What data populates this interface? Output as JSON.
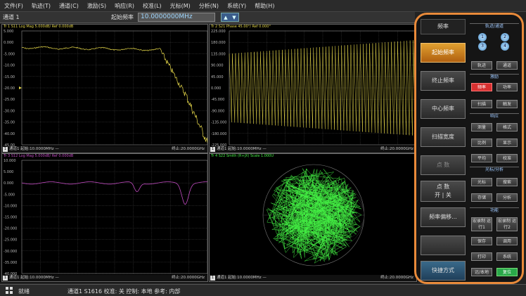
{
  "menubar": {
    "items": [
      "文件(F)",
      "轨迹(T)",
      "通道(C)",
      "激励(S)",
      "响应(R)",
      "校准(L)",
      "光标(M)",
      "分析(N)",
      "系统(Y)",
      "帮助(H)"
    ]
  },
  "toolbar": {
    "channel": "通道 1",
    "start_label": "起始频率",
    "start_value": "10.0000000MHz",
    "spin_up": "▲",
    "spin_down": "▼"
  },
  "trace1": {
    "header": "Tr 1  S11 Log Mag 5.000dB/ Ref 0.000dB",
    "y_ticks": [
      "5.000",
      "0.000",
      "-5.000",
      "-10.00",
      "-15.00",
      "-20.00",
      "-25.00",
      "-30.00",
      "-35.00",
      "-40.00",
      "-45.00"
    ],
    "footer_ch": "1",
    "footer_left": "通道1  起始:10.0000MHz  —",
    "footer_right": "终止:20.0000GHz"
  },
  "trace2": {
    "header": "Tr 2  S21 Phase 45.00°/ Ref 0.000°",
    "y_ticks": [
      "225.000",
      "180.000",
      "135.000",
      "90.000",
      "45.000",
      "0.000",
      "-45.000",
      "-90.000",
      "-135.000",
      "-180.000",
      "-225.000"
    ],
    "footer_ch": "1",
    "footer_left": "通道1  起始:10.0000MHz  —",
    "footer_right": "终止:20.0000GHz"
  },
  "trace3": {
    "header": "Tr 3  S12 Log Mag 5.000dB/ Ref 0.000dB",
    "y_ticks": [
      "10.000",
      "5.000",
      "0.000",
      "-5.000",
      "-10.000",
      "-15.000",
      "-20.000",
      "-25.000",
      "-30.000",
      "-35.000",
      "-40.000"
    ],
    "footer_ch": "1",
    "footer_left": "通道1  起始:10.0000MHz  —",
    "footer_right": "终止:20.0000GHz"
  },
  "trace4": {
    "header": "Tr 4  S22 Smith (R+jX) Scale 1.000U",
    "footer_ch": "1",
    "footer_left": "通道1  起始:10.0000MHz  —",
    "footer_right": "终止:20.0000GHz"
  },
  "panel": {
    "title": "频率",
    "buttons": [
      "起始频率",
      "终止频率",
      "中心频率",
      "扫描宽度",
      "点 数",
      "点 数\n开 | 关",
      "频率偏移...",
      "",
      "快捷方式"
    ],
    "groups": {
      "trace": "轨迹/通道",
      "stim": "激励",
      "resp": "响应",
      "marker": "光标/分析",
      "util": "功能"
    },
    "trace_circles": [
      "1",
      "2",
      "3",
      "4"
    ],
    "small": {
      "trace_btn": "轨迹",
      "chan_btn": "通道",
      "freq": "频率",
      "power": "功率",
      "sweep": "扫描",
      "trigger": "触发",
      "meas": "测量",
      "format": "格式",
      "scale": "比例",
      "display": "显示",
      "avg": "平均",
      "cal": "校准",
      "marker": "光标",
      "search": "搜索",
      "store": "存储",
      "analysis": "分析",
      "macro1": "宏录制 运行1",
      "macro2": "宏录制 运行2",
      "save": "保存",
      "recall": "调用",
      "print": "打印",
      "system": "系统",
      "local": "远/本地",
      "preset": "复位"
    }
  },
  "status": {
    "ready": "就绪",
    "info": "通道1  S1616  校准: 关  控制: 本地  参考: 内部"
  },
  "colors": {
    "accent": "#e98a3a",
    "trace1": "#e6d84a",
    "trace2": "#e6d84a",
    "trace3": "#c04ac0",
    "trace4": "#44f044"
  }
}
